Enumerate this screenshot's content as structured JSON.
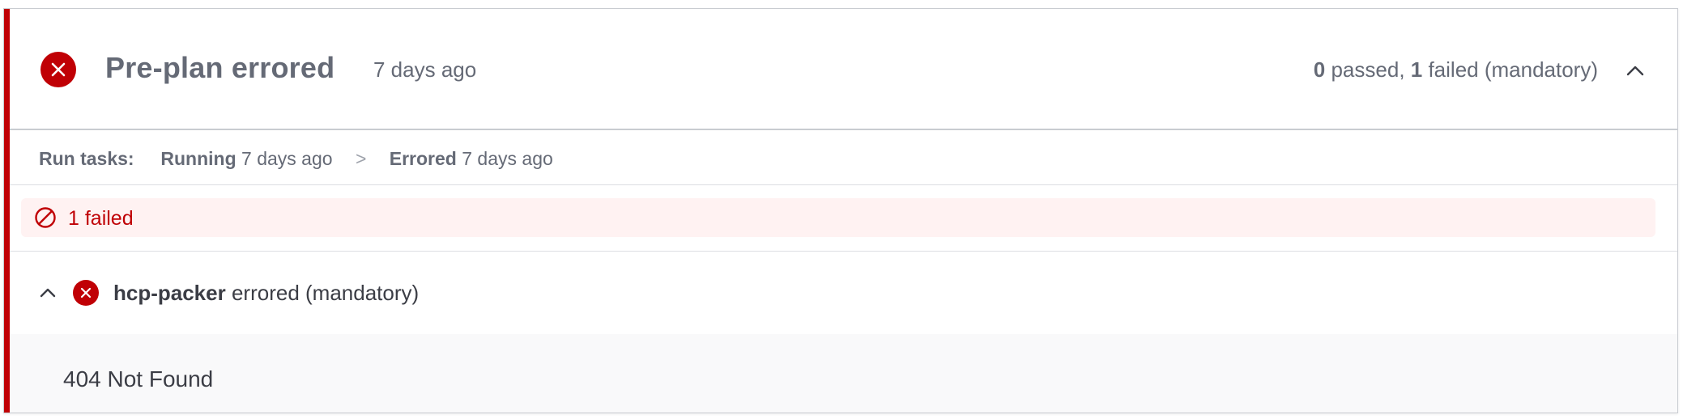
{
  "header": {
    "title": "Pre-plan errored",
    "time": "7 days ago",
    "summary": {
      "passed_count": "0",
      "passed_label": " passed, ",
      "failed_count": "1",
      "failed_label": " failed (mandatory)"
    },
    "status_icon": "error-circle-icon",
    "collapse_icon": "chevron-up-icon"
  },
  "run_tasks": {
    "label": "Run tasks:",
    "steps": [
      {
        "state": "Running",
        "time": "7 days ago"
      },
      {
        "state": "Errored",
        "time": "7 days ago"
      }
    ],
    "separator": ">"
  },
  "failed_banner": {
    "text": "1 failed",
    "icon": "prohibited-icon"
  },
  "task": {
    "name": "hcp-packer",
    "status": " errored (mandatory)",
    "expand_icon": "chevron-up-icon",
    "status_icon": "error-circle-icon",
    "output": "404 Not Found"
  },
  "colors": {
    "error": "#c00005",
    "error_bg": "#fff2f2",
    "text_muted": "#656a76",
    "text_strong": "#3b3d45"
  }
}
